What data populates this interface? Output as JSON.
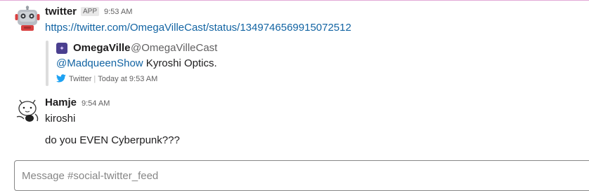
{
  "messages": [
    {
      "sender": "twitter",
      "badge": "APP",
      "time": "9:53 AM",
      "link": "https://twitter.com/OmegaVilleCast/status/1349746569915072512",
      "attachment": {
        "author_name": "OmegaVille",
        "author_handle": "@OmegaVilleCast",
        "mention": "@MadqueenShow",
        "text_rest": " Kyroshi Optics.",
        "footer_source": "Twitter",
        "footer_time": "Today at 9:53 AM"
      }
    },
    {
      "sender": "Hamje",
      "time": "9:54 AM",
      "lines": [
        "kiroshi",
        "do you EVEN Cyberpunk???"
      ]
    }
  ],
  "composer": {
    "placeholder": "Message #social-twitter_feed"
  },
  "colors": {
    "link": "#1264a3",
    "twitter_blue": "#1da1f2",
    "divider": "#e2a8d6"
  },
  "icons": {
    "bot_avatar": "robot-avatar-icon",
    "user_avatar": "cat-sketch-avatar-icon",
    "source": "twitter-bird-icon"
  }
}
